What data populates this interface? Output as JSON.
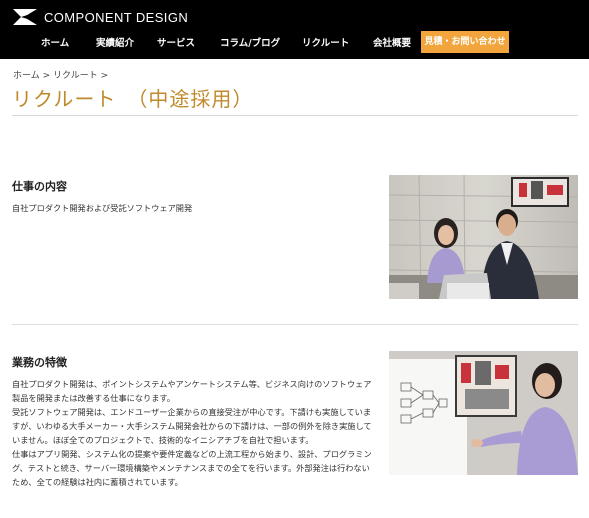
{
  "header": {
    "logo_text": "COMPONENT  DESIGN",
    "nav": [
      {
        "label": "ホーム"
      },
      {
        "label": "実績紹介"
      },
      {
        "label": "サービス"
      },
      {
        "label": "コラム/ブログ"
      },
      {
        "label": "リクルート"
      },
      {
        "label": "会社概要"
      }
    ],
    "cta_label": "見積・お問い合わせ"
  },
  "breadcrumb": {
    "home": "ホーム",
    "sep1": " > ",
    "current": "リクルート",
    "sep2": " >"
  },
  "page_title": "リクルート　（中途採用）",
  "sections": [
    {
      "heading": "仕事の内容",
      "paragraphs": [
        "自社プロダクト開発および受託ソフトウェア開発"
      ]
    },
    {
      "heading": "業務の特徴",
      "paragraphs": [
        "自社プロダクト開発は、ポイントシステムやアンケートシステム等、ビジネス向けのソフトウェア製品を開発または改善する仕事になります。",
        "受託ソフトウェア開発は、エンドユーザー企業からの直接受注が中心です。下請けも実施していますが、いわゆる大手メーカー・大手システム開発会社からの下請けは、一部の例外を除き実施していません。ほぼ全てのプロジェクトで、技術的なイニシアチブを自社で担います。",
        "仕事はアプリ開発、システム化の提案や要件定義などの上流工程から始まり、設計、プログラミング、テストと続き、サーバー環境構築やメンテナンスまでの全てを行います。外部発注は行わないため、全ての経験は社内に蓄積されています。"
      ]
    }
  ],
  "colors": {
    "accent": "#c08a2c",
    "cta": "#f2a53c",
    "header_bg": "#000000"
  }
}
